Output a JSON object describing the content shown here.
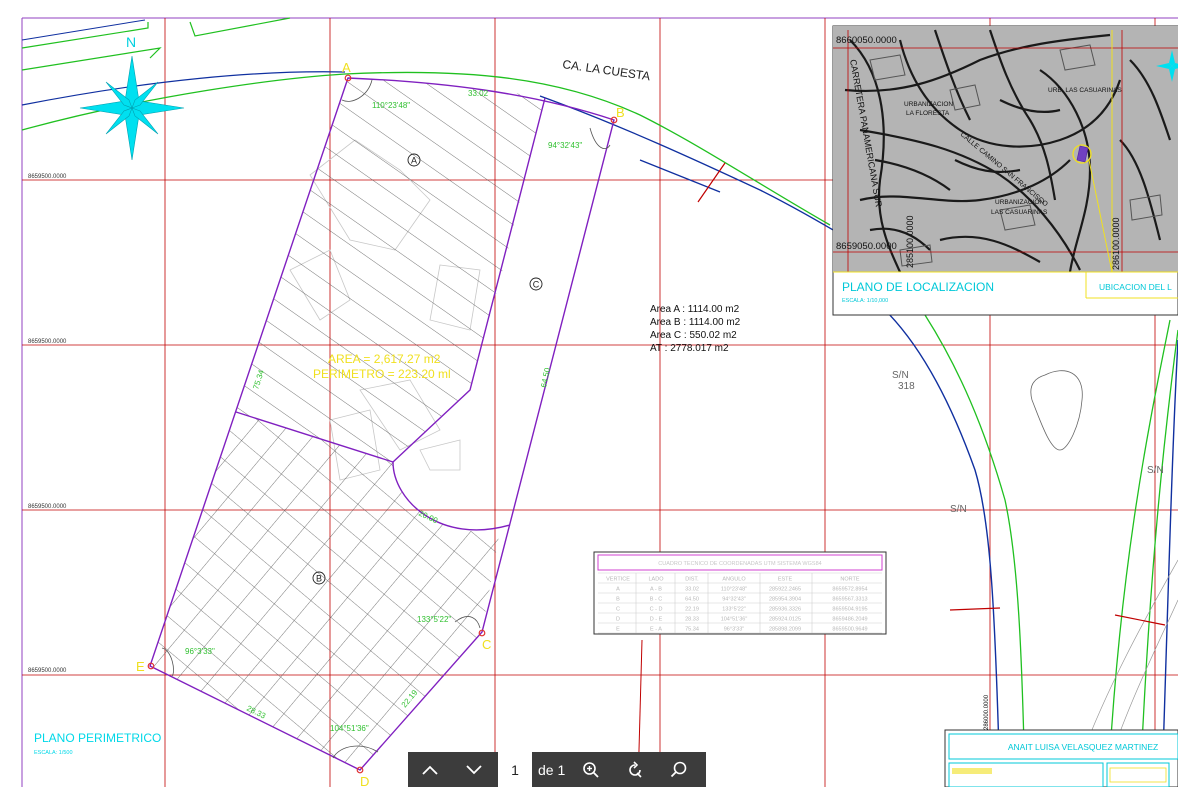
{
  "street": {
    "name": "CA. LA CUESTA"
  },
  "compass": {
    "north": "N"
  },
  "grid_labels": {
    "e1": "8659500.0000",
    "e2": "8659500.0000",
    "e3": "8659500.0000",
    "e4": "8659500.0000"
  },
  "vertices": {
    "a": "A",
    "b": "B",
    "c": "C",
    "d": "D",
    "e": "E"
  },
  "zone_markers": {
    "a": "A",
    "b": "B",
    "c": "C"
  },
  "angles": {
    "a": "110°23'48\"",
    "b": "94°32'43\"",
    "c": "133°5'22\"",
    "d": "104°51'36\"",
    "e": "96°3'33\""
  },
  "distances": {
    "ab": "33.02",
    "bc": "64.50",
    "left": "75.34",
    "de": "28.33",
    "cd": "22.19",
    "arc": "20.00"
  },
  "area_overlay": {
    "line1": "AREA = 2,617.27 m2",
    "line2": "PERIMETRO = 223.20 ml"
  },
  "area_summary": {
    "line1": "Area A : 1114.00 m2",
    "line2": "Area B : 1114.00 m2",
    "line3": "Area C : 550.02 m2",
    "line4": "AT : 2778.017 m2"
  },
  "utm_table": {
    "title": "CUADRO TECNICO DE COORDENADAS UTM SISTEMA WGS84",
    "headers": [
      "VERTICE",
      "LADO",
      "DIST.",
      "ANGULO",
      "ESTE",
      "NORTE"
    ],
    "rows": [
      [
        "A",
        "A - B",
        "33.02",
        "110°23'48\"",
        "285922.2465",
        "8659572.8954"
      ],
      [
        "B",
        "B - C",
        "64.50",
        "94°32'43\"",
        "285954.3904",
        "8659567.3313"
      ],
      [
        "C",
        "C - D",
        "22.19",
        "133°5'22\"",
        "285936.3326",
        "8659504.9195"
      ],
      [
        "D",
        "D - E",
        "28.33",
        "104°51'36\"",
        "285924.0125",
        "8659486.2049"
      ],
      [
        "E",
        "E - A",
        "75.34",
        "96°3'33\"",
        "285898.2099",
        "8659500.9649"
      ]
    ]
  },
  "sn_labels": {
    "first": "S/N",
    "first_num": "318",
    "second": "S/N",
    "third": "S/N"
  },
  "plan_title": {
    "title": "PLANO PERIMETRICO",
    "scale": "ESCALA: 1/500"
  },
  "location_map": {
    "title": "PLANO DE LOCALIZACION",
    "scale": "ESCALA: 1/10,000",
    "subtitle": "UBICACION DEL L",
    "coord_top": "8660050.0000",
    "coord_bottom": "8659050.0000",
    "coord_left": "285100.0000",
    "coord_right": "286100.0000",
    "urb1_a": "URBANIZACION",
    "urb1_b": "LA FLORESTA",
    "urb2": "URB. LAS CASUARINAS",
    "urb3_a": "URBANIZACION",
    "urb3_b": "LAS CASUARINAS",
    "road": "CARRETERA PANAMERICANA SUR",
    "street2": "CALLE CAMINO SAN FRANCISCO"
  },
  "vertical_coord": "286000.0000",
  "cartouche": {
    "author": "ANAIT LUISA VELASQUEZ MARTINEZ"
  },
  "viewer": {
    "page": "1",
    "of_label": "de 1"
  },
  "colors": {
    "grid": "#c00000",
    "polygon": "#8020c0",
    "green": "#20c020",
    "road_blue": "#1030a0",
    "cyan": "#00e0f0",
    "yellow": "#f0e020"
  }
}
